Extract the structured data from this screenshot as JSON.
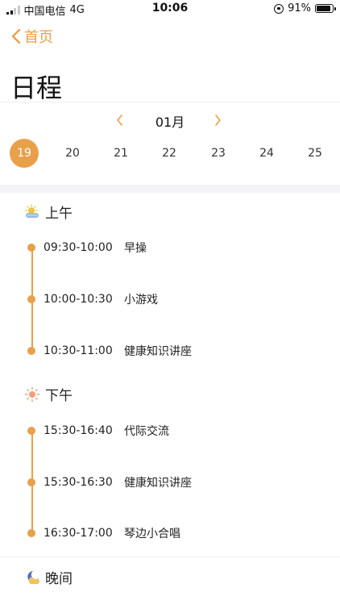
{
  "status_bar": {
    "carrier": "中国电信",
    "network": "4G",
    "time": "10:06",
    "battery": "91%",
    "battery_level": 0.91
  },
  "nav": {
    "back_label": "首页"
  },
  "page": {
    "title": "日程"
  },
  "calendar": {
    "month": "01月",
    "days": [
      "19",
      "20",
      "21",
      "22",
      "23",
      "24",
      "25"
    ],
    "selected_day": "19"
  },
  "sections": [
    {
      "title": "上午",
      "icon": "partly-cloudy-sun-icon",
      "events": [
        {
          "time": "09:30-10:00",
          "name": "早操"
        },
        {
          "time": "10:00-10:30",
          "name": "小游戏"
        },
        {
          "time": "10:30-11:00",
          "name": "健康知识讲座"
        }
      ]
    },
    {
      "title": "下午",
      "icon": "sun-icon",
      "events": [
        {
          "time": "15:30-16:40",
          "name": "代际交流"
        },
        {
          "time": "15:30-16:30",
          "name": "健康知识讲座"
        },
        {
          "time": "16:30-17:00",
          "name": "琴边小合唱"
        }
      ]
    },
    {
      "title": "晚间",
      "icon": "moon-cloud-icon",
      "events": []
    }
  ],
  "colors": {
    "accent": "#e9a04a",
    "band": "#f4f4f6"
  }
}
